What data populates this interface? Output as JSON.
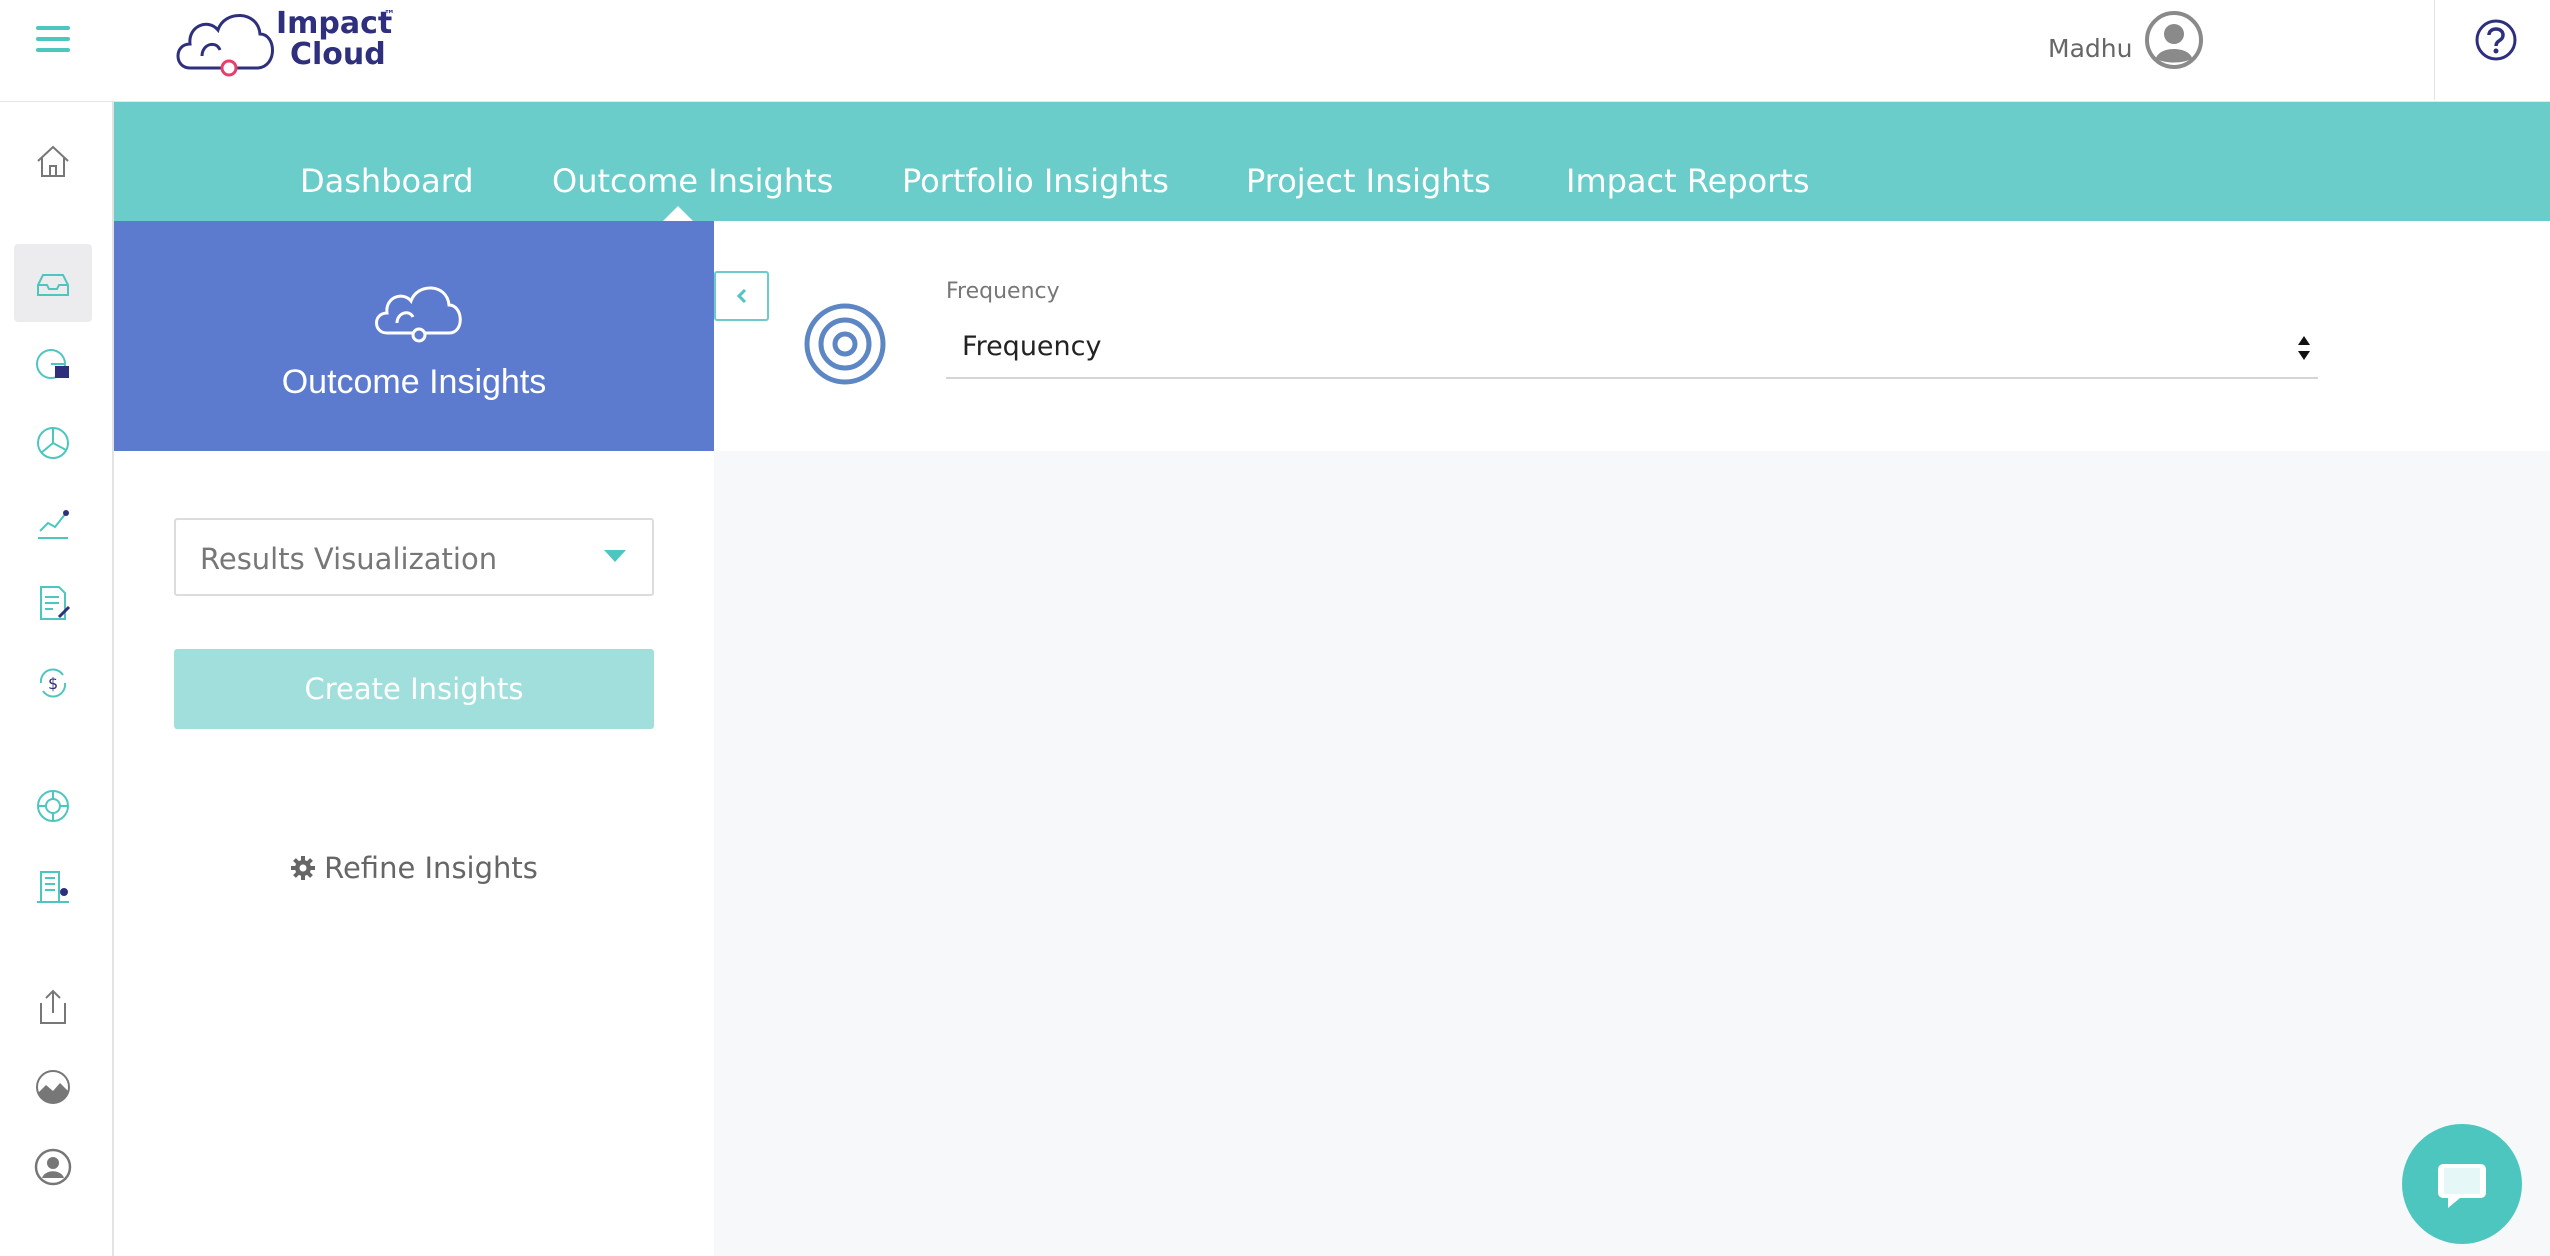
{
  "app": {
    "logo_line1": "Impact",
    "logo_line2": "Cloud",
    "logo_tm": "™"
  },
  "header": {
    "user_name": "Madhu"
  },
  "nav": {
    "tabs": [
      {
        "label": "Dashboard"
      },
      {
        "label": "Outcome Insights"
      },
      {
        "label": "Portfolio Insights"
      },
      {
        "label": "Project Insights"
      },
      {
        "label": "Impact Reports"
      }
    ],
    "active_tab": "Outcome Insights"
  },
  "sidebar_panel": {
    "title": "Outcome Insights",
    "select_value": "Results Visualization",
    "create_button": "Create Insights",
    "refine_link": "Refine Insights"
  },
  "main": {
    "frequency_label": "Frequency",
    "frequency_value": "Frequency"
  },
  "rail": {
    "icons": [
      "home-icon",
      "inbox-icon",
      "pie-report-icon",
      "globe-chart-icon",
      "trend-chart-icon",
      "document-edit-icon",
      "currency-cycle-icon",
      "lifebuoy-icon",
      "building-icon",
      "export-icon",
      "landscape-icon",
      "user-profile-icon"
    ],
    "active": "inbox-icon"
  },
  "colors": {
    "accent": "#4ec6c0",
    "nav_bg": "#6acdca",
    "panel_head": "#5c7bcf",
    "brand_text": "#2e2f7d"
  }
}
